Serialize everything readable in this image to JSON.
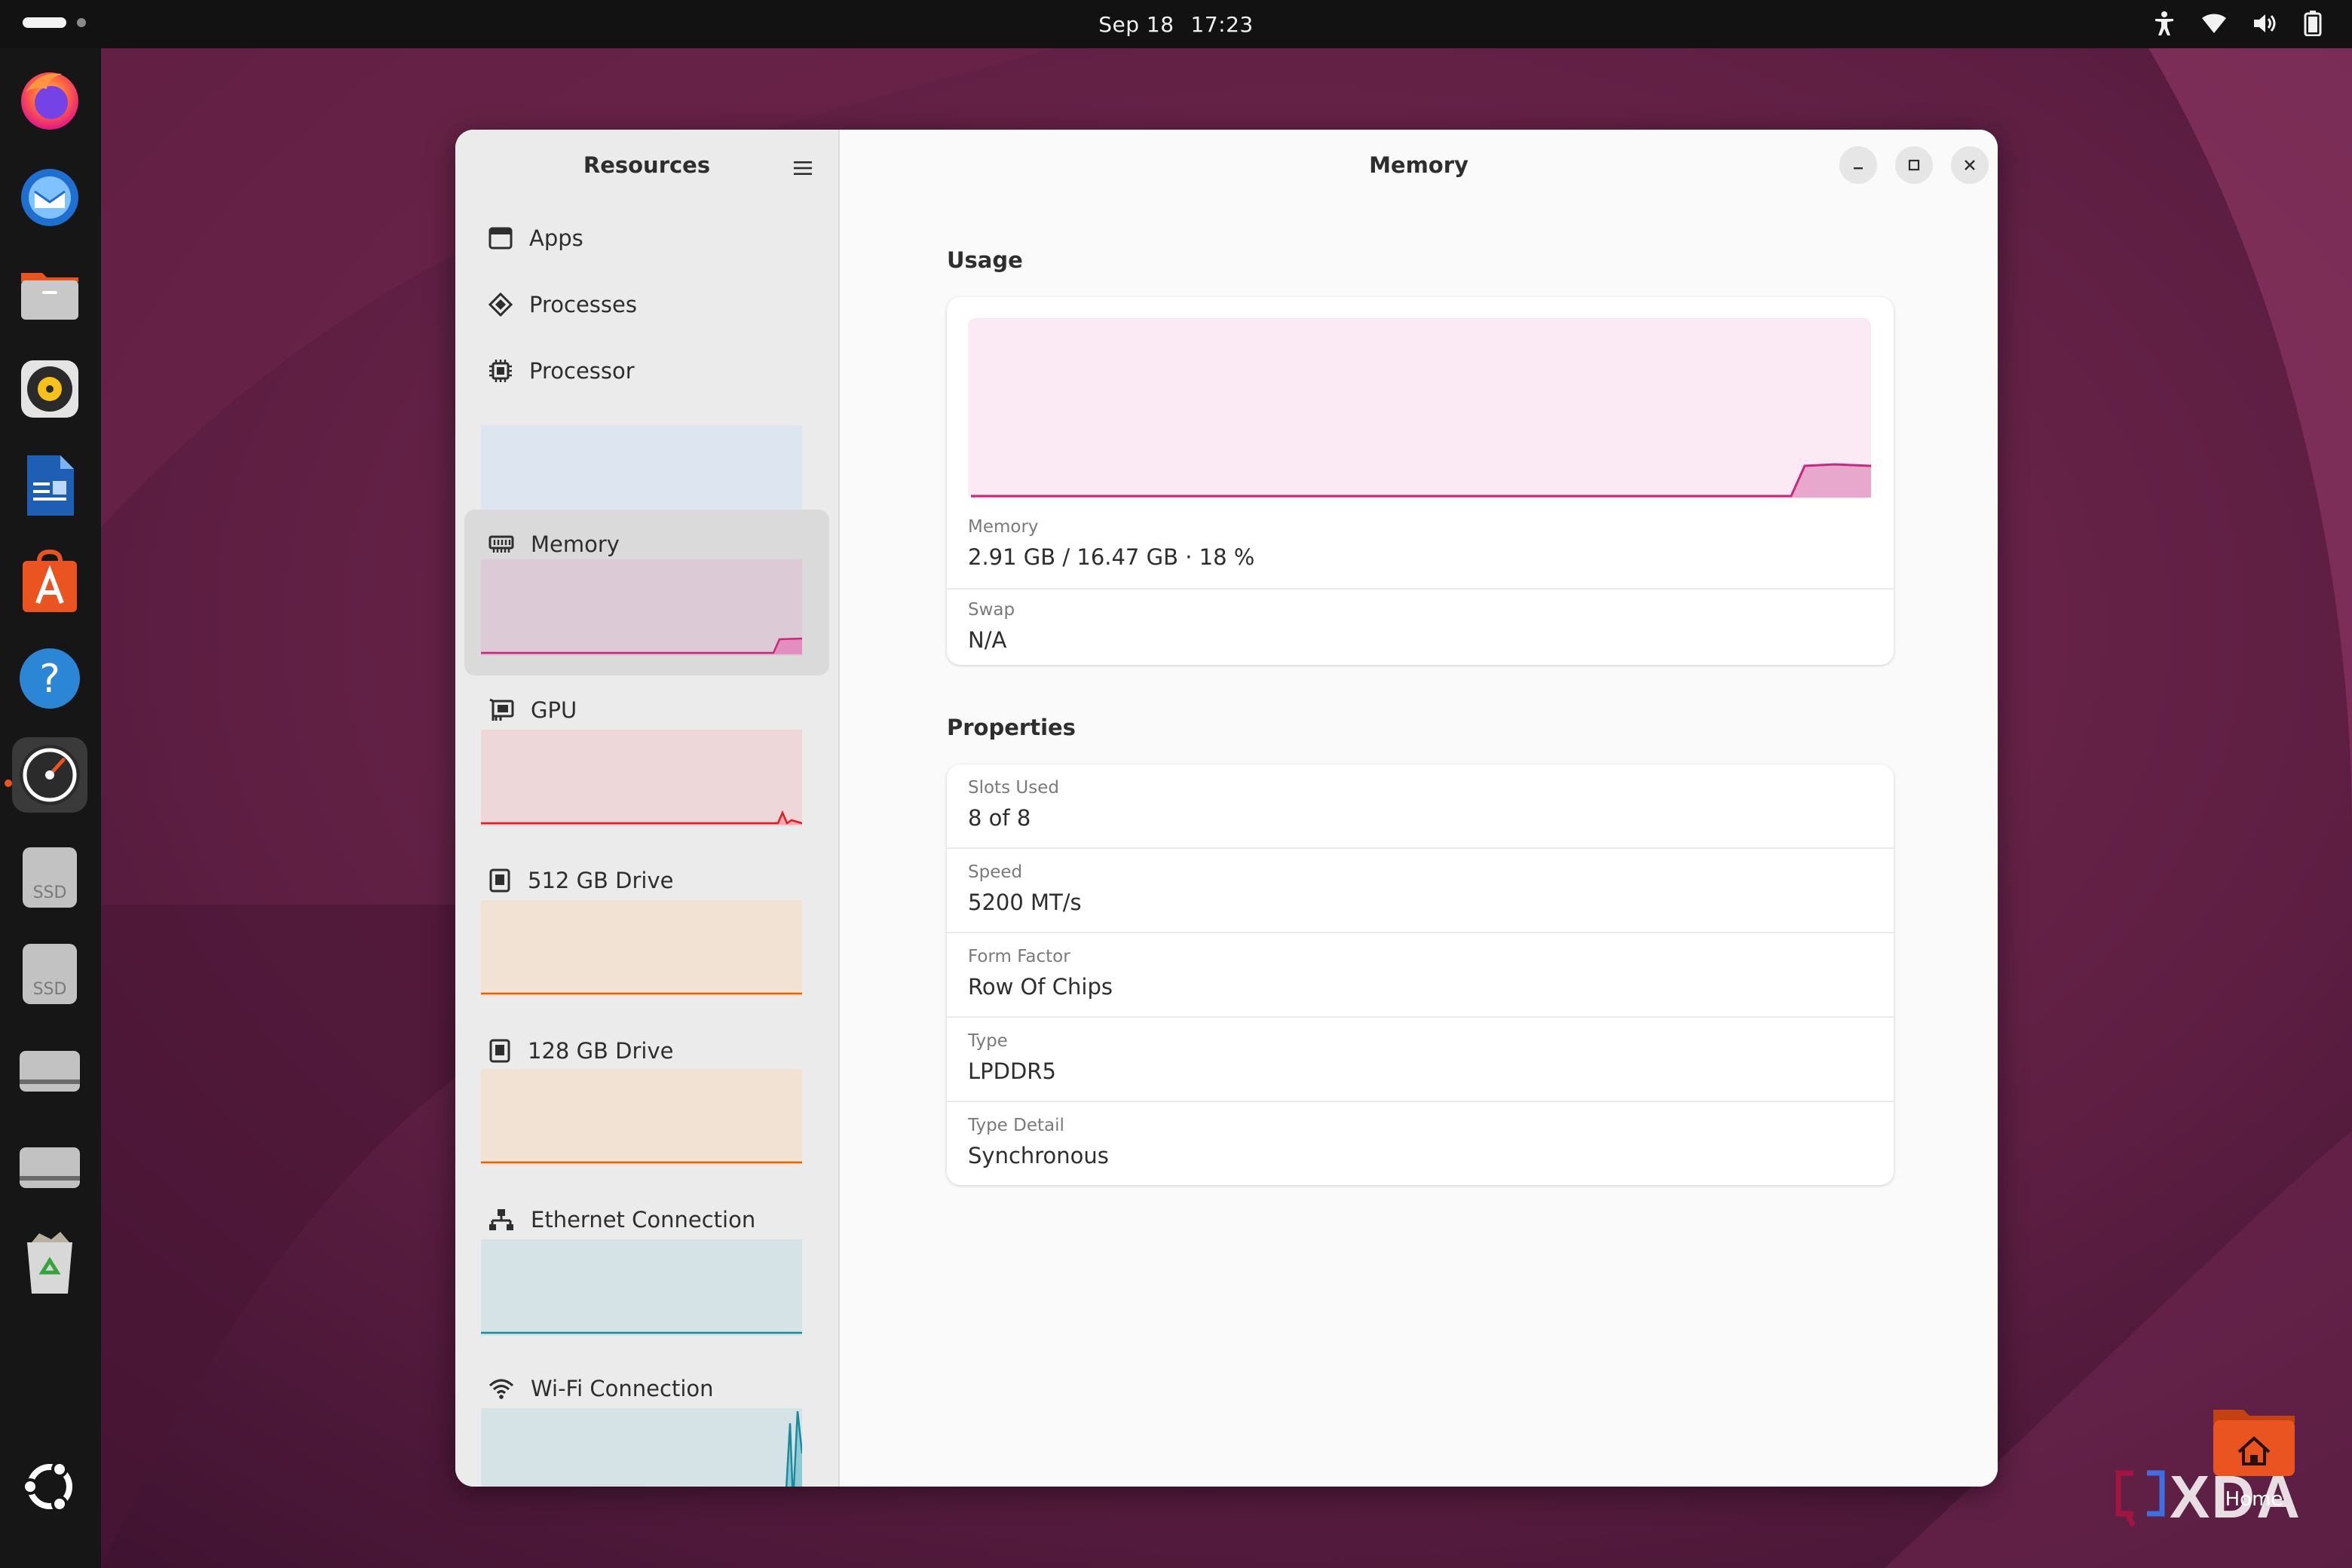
{
  "topbar": {
    "date": "Sep 18",
    "time": "17:23"
  },
  "dock": {
    "items": [
      {
        "name": "firefox-icon"
      },
      {
        "name": "thunderbird-icon"
      },
      {
        "name": "files-icon"
      },
      {
        "name": "rhythmbox-icon"
      },
      {
        "name": "writer-icon"
      },
      {
        "name": "app-center-icon"
      },
      {
        "name": "help-icon"
      },
      {
        "name": "resources-icon",
        "active": true
      },
      {
        "name": "ssd-drive-icon",
        "label": "SSD"
      },
      {
        "name": "ssd-drive-icon",
        "label": "SSD"
      },
      {
        "name": "drive-icon"
      },
      {
        "name": "drive-icon"
      },
      {
        "name": "trash-icon"
      }
    ],
    "ssd_label_1": "SSD",
    "ssd_label_2": "SSD"
  },
  "sidebar": {
    "title": "Resources",
    "items": [
      {
        "label": "Apps",
        "icon": "window-icon"
      },
      {
        "label": "Processes",
        "icon": "processes-icon"
      },
      {
        "label": "Processor",
        "icon": "chip-icon",
        "color": "#3584e4"
      },
      {
        "label": "Memory",
        "icon": "memory-icon",
        "color": "#c6297e",
        "selected": true
      },
      {
        "label": "GPU",
        "icon": "gpu-icon",
        "color": "#e01b24"
      },
      {
        "label": "512 GB Drive",
        "icon": "drive-icon",
        "color": "#e66100"
      },
      {
        "label": "128 GB Drive",
        "icon": "drive-icon",
        "color": "#e66100"
      },
      {
        "label": "Ethernet Connection",
        "icon": "network-icon",
        "color": "#1c8a9e"
      },
      {
        "label": "Wi-Fi Connection",
        "icon": "wifi-icon",
        "color": "#1c8a9e"
      }
    ]
  },
  "main": {
    "title": "Memory",
    "usage": {
      "heading": "Usage",
      "memory_label": "Memory",
      "memory_value": "2.91 GB / 16.47 GB · 18 %",
      "memory_percent": 18,
      "swap_label": "Swap",
      "swap_value": "N/A"
    },
    "properties": {
      "heading": "Properties",
      "rows": [
        {
          "label": "Slots Used",
          "value": "8 of 8"
        },
        {
          "label": "Speed",
          "value": "5200 MT/s"
        },
        {
          "label": "Form Factor",
          "value": "Row Of Chips"
        },
        {
          "label": "Type",
          "value": "LPDDR5"
        },
        {
          "label": "Type Detail",
          "value": "Synchronous"
        }
      ]
    }
  },
  "desktop": {
    "home_label": "Home",
    "watermark": "XDA"
  },
  "colors": {
    "accent": "#c6297e",
    "wallpaper": "#5a1f40",
    "panel": "#121212"
  }
}
